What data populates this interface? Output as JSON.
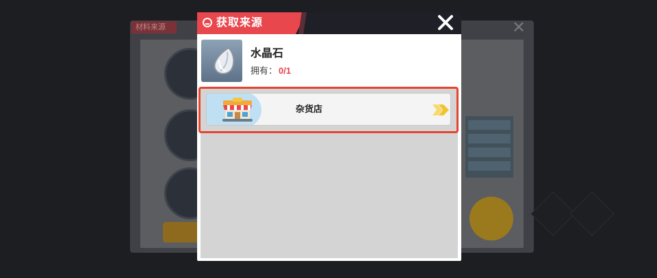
{
  "background": {
    "tag_label": "材料来源"
  },
  "modal": {
    "title": "获取来源",
    "close_label": "X",
    "item": {
      "name": "水晶石",
      "own_label": "拥有：",
      "own_count": "0/1",
      "icon": "crystal-stone-icon"
    },
    "sources": [
      {
        "label": "杂货店",
        "icon": "shop-icon",
        "action_icon": "go-arrow-icon"
      }
    ]
  },
  "colors": {
    "accent_red": "#e8474d",
    "header_dark": "#1f2027",
    "highlight_border": "#e8432f",
    "count_red": "#e6434c",
    "arrow_yellow": "#f2c230"
  }
}
